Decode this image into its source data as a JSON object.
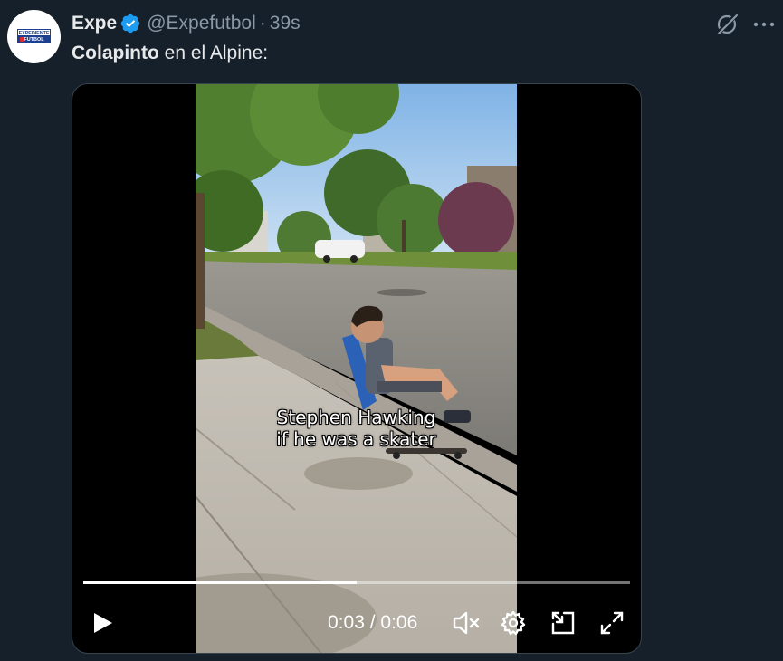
{
  "author": {
    "display_name": "Expe",
    "handle": "@Expefutbol",
    "separator": "·",
    "timestamp": "39s",
    "avatar_text_top": "EXPEDIENTE",
    "avatar_text_bottom": "FUTBOL"
  },
  "tweet": {
    "bold_text": "Colapinto",
    "text": " en el Alpine:"
  },
  "video": {
    "caption_line1": "Stephen Hawking",
    "caption_line2": "if he was a skater",
    "current_time": "0:03",
    "time_separator": " / ",
    "duration": "0:06",
    "progress": 0.5
  },
  "icons": {
    "verified": "verified-badge-icon",
    "grok": "grok-icon",
    "more": "more-icon",
    "play": "play-icon",
    "mute": "volume-muted-icon",
    "settings": "gear-icon",
    "pip": "picture-in-picture-icon",
    "fullscreen": "expand-icon"
  },
  "colors": {
    "background": "#15202b",
    "verified": "#1d9bf0",
    "secondary_text": "#8b98a5"
  }
}
